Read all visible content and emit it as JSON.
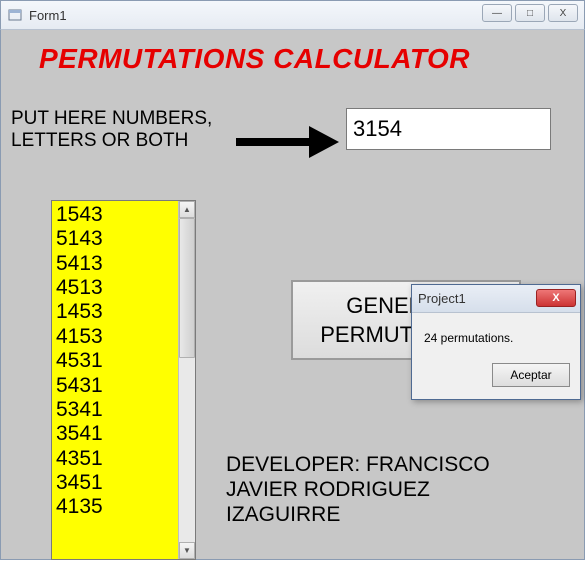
{
  "window": {
    "title": "Form1",
    "minimize_glyph": "—",
    "maximize_glyph": "□",
    "close_glyph": "X"
  },
  "heading": "PERMUTATIONS CALCULATOR",
  "input_label_line1": "PUT HERE NUMBERS,",
  "input_label_line2": "LETTERS OR BOTH",
  "input_value": "3154",
  "listbox_items": [
    "1543",
    "5143",
    "5413",
    "4513",
    "1453",
    "4153",
    "4531",
    "5431",
    "5341",
    "3541",
    "4351",
    "3451",
    "4135"
  ],
  "generate_label_line1": "GENERATE",
  "generate_label_line2": "PERMUTATIONS",
  "credits_line1": "DEVELOPER: FRANCISCO",
  "credits_line2": "JAVIER RODRIGUEZ",
  "credits_line3": "IZAGUIRRE",
  "dialog": {
    "title": "Project1",
    "message": "24 permutations.",
    "ok_label": "Aceptar",
    "close_glyph": "X"
  }
}
